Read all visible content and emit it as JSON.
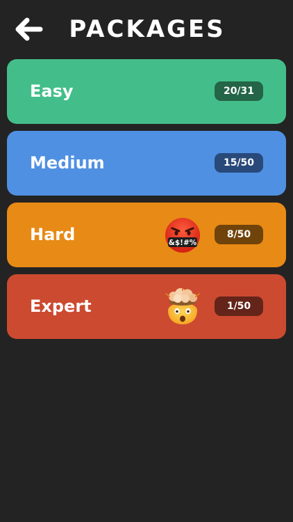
{
  "header": {
    "title": "PACKAGES",
    "back_icon": "arrow-left-icon"
  },
  "packages": [
    {
      "name": "Easy",
      "progress": "20/31",
      "color": "#43be8a",
      "badge_color": "#246447"
    },
    {
      "name": "Medium",
      "progress": "15/50",
      "color": "#4f90e2",
      "badge_color": "#28497a"
    },
    {
      "name": "Hard",
      "progress": "8/50",
      "color": "#e88a16",
      "badge_color": "#6f430a",
      "emoji_text": "&$!#%",
      "emoji": "cursing-face-icon"
    },
    {
      "name": "Expert",
      "progress": "1/50",
      "color": "#cc4a30",
      "badge_color": "#64241a",
      "emoji": "exploding-head-icon"
    }
  ],
  "colors": {
    "background": "#232323",
    "text": "#ffffff"
  }
}
